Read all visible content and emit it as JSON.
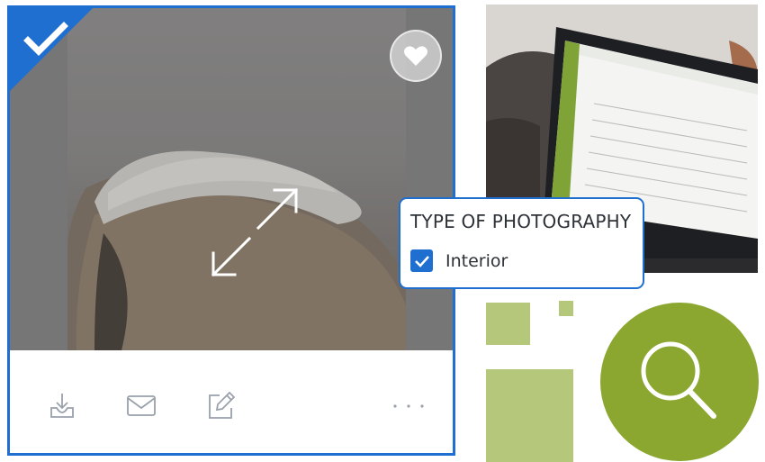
{
  "card": {
    "selected": true,
    "favorite": false,
    "actions": [
      "download-icon",
      "mail-icon",
      "edit-icon",
      "more-icon"
    ]
  },
  "filter": {
    "title": "TYPE OF PHOTOGRAPHY",
    "options": [
      {
        "label": "Interior",
        "checked": true
      }
    ]
  },
  "colors": {
    "accent_blue": "#1f6fd1",
    "brand_green": "#8ba730",
    "light_green": "#b5c77a"
  }
}
